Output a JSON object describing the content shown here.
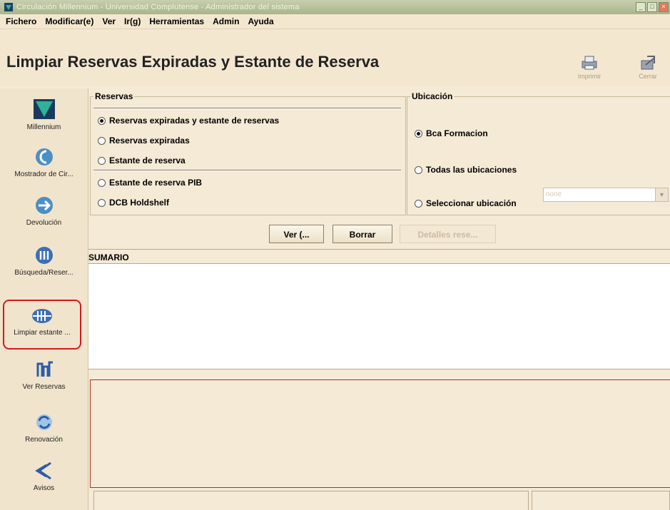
{
  "window": {
    "title": "Circulación Millennium - Universidad Complutense - Administrador del sistema",
    "controls": [
      "minimize",
      "maximize",
      "close"
    ]
  },
  "menu": [
    {
      "label": "Fichero"
    },
    {
      "label": "Modificar(e)"
    },
    {
      "label": "Ver"
    },
    {
      "label": "Ir(g)"
    },
    {
      "label": "Herramientas"
    },
    {
      "label": "Admin"
    },
    {
      "label": "Ayuda"
    }
  ],
  "page": {
    "title": "Limpiar Reservas Expiradas y Estante de Reserva"
  },
  "toolbar": {
    "print_label": "Imprimir",
    "close_label": "Cerrar"
  },
  "sidebar": {
    "items": [
      {
        "label": "Millennium",
        "icon": "millennium-logo-icon"
      },
      {
        "label": "Mostrador de Cir...",
        "icon": "circulation-desk-icon"
      },
      {
        "label": "Devolución",
        "icon": "checkin-arrow-icon"
      },
      {
        "label": "Búsqueda/Reser...",
        "icon": "search-hold-icon"
      },
      {
        "label": "Limpiar estante ...",
        "icon": "clear-shelf-icon",
        "selected": true
      },
      {
        "label": "Ver Reservas",
        "icon": "view-holds-icon"
      },
      {
        "label": "Renovación",
        "icon": "renewal-icon"
      },
      {
        "label": "Avisos",
        "icon": "notices-icon"
      }
    ]
  },
  "reservas": {
    "legend": "Reservas",
    "options": [
      {
        "label": "Reservas expiradas y estante de reservas",
        "checked": true
      },
      {
        "label": "Reservas expiradas",
        "checked": false
      },
      {
        "label": "Estante de reserva",
        "checked": false
      },
      {
        "label": "Estante de reserva PIB",
        "checked": false
      },
      {
        "label": "DCB Holdshelf",
        "checked": false
      }
    ]
  },
  "ubicacion": {
    "legend": "Ubicación",
    "options": [
      {
        "label": "Bca Formacion",
        "checked": true
      },
      {
        "label": "Todas las ubicaciones",
        "checked": false
      },
      {
        "label": "Seleccionar ubicación",
        "checked": false
      }
    ],
    "select_value": "none"
  },
  "buttons": {
    "view": "Ver (...",
    "clear": "Borrar",
    "details": "Detalles rese..."
  },
  "summary": {
    "label": "SUMARIO"
  },
  "colors": {
    "background": "#f5ead6",
    "selection_ring": "#d21b1b",
    "accent": "#1f5d8f"
  }
}
